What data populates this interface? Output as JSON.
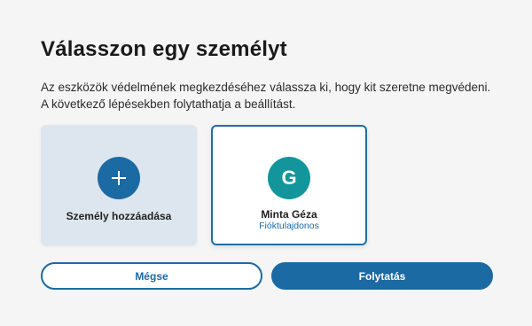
{
  "page": {
    "title": "Válasszon egy személyt",
    "description_line1": "Az eszközök védelmének megkezdéséhez válassza ki, hogy kit szeretne megvédeni.",
    "description_line2": "A következő lépésekben folytathatja a beállítást."
  },
  "add_person": {
    "label": "Személy hozzáadása",
    "icon": "plus-icon"
  },
  "person": {
    "initial": "G",
    "name": "Minta Géza",
    "role": "Fióktulajdonos",
    "selected": true
  },
  "actions": {
    "cancel_label": "Mégse",
    "continue_label": "Folytatás"
  },
  "colors": {
    "accent": "#1b6aa3",
    "avatar": "#13969b",
    "add_card_bg": "#dde6ee",
    "page_bg": "#f5f5f5"
  }
}
